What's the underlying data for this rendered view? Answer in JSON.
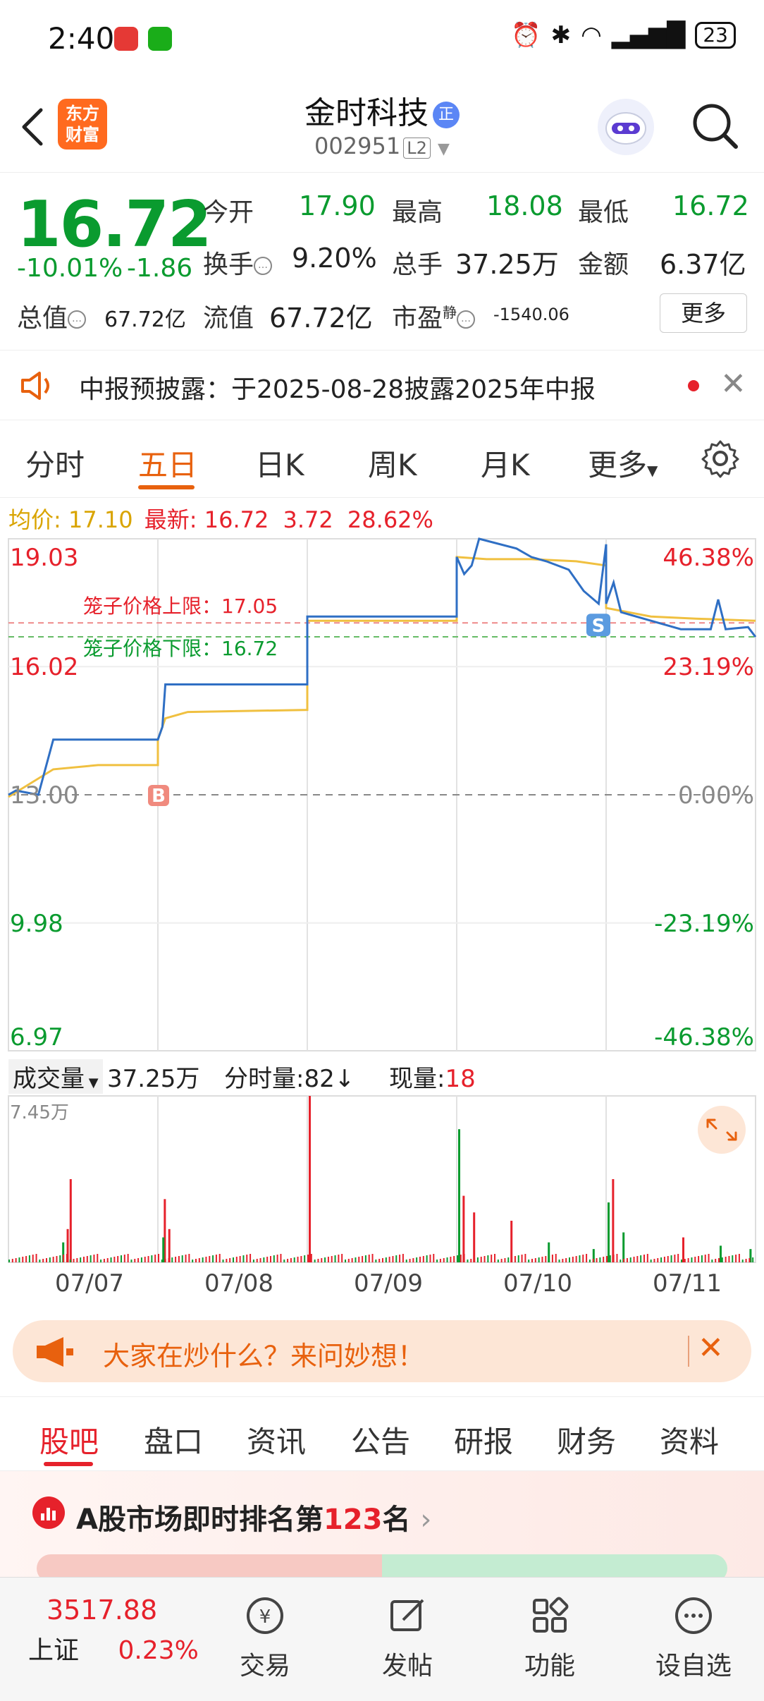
{
  "status_bar": {
    "time": "2:40",
    "battery": "23"
  },
  "header": {
    "logo_text": "东方\n财富",
    "stock_name": "金时科技",
    "official_badge": "正",
    "stock_code": "002951",
    "level_badge": "L2"
  },
  "quote": {
    "price": "16.72",
    "change_pct": "-10.01%",
    "change_amt": "-1.86",
    "fields": {
      "open_label": "今开",
      "open": "17.90",
      "high_label": "最高",
      "high": "18.08",
      "low_label": "最低",
      "low": "16.72",
      "turnover_label": "换手",
      "turnover": "9.20%",
      "volume_label": "总手",
      "volume": "37.25万",
      "amount_label": "金额",
      "amount": "6.37亿",
      "mktcap_label": "总值",
      "mktcap": "67.72亿",
      "float_label": "流值",
      "float": "67.72亿",
      "pe_label": "市盈",
      "pe_sup": "静",
      "pe": "-1540.06"
    },
    "more_button": "更多"
  },
  "notice": {
    "text": "中报预披露：于2025-08-28披露2025年中报"
  },
  "chart_tabs": [
    "分时",
    "五日",
    "日K",
    "周K",
    "月K",
    "更多"
  ],
  "legend": {
    "avg_label": "均价:",
    "avg": "17.10",
    "latest_label": "最新:",
    "latest": "16.72",
    "chg": "3.72",
    "chg_pct": "28.62%"
  },
  "chart_data": {
    "type": "line",
    "title": "",
    "x": [
      "07/07",
      "07/08",
      "07/09",
      "07/10",
      "07/11"
    ],
    "y_left_ticks": [
      "19.03",
      "16.02",
      "13.00",
      "9.98",
      "6.97"
    ],
    "y_right_ticks": [
      "46.38%",
      "23.19%",
      "0.00%",
      "-23.19%",
      "-46.38%"
    ],
    "ylim": [
      6.97,
      19.03
    ],
    "reference_lines": [
      {
        "label": "笼子价格上限：",
        "value": "17.05"
      },
      {
        "label": "笼子价格下限：",
        "value": "16.72"
      }
    ],
    "markers": [
      {
        "label": "B",
        "day": "07/08"
      },
      {
        "label": "S",
        "day": "07/11"
      }
    ],
    "series": [
      {
        "name": "最新",
        "color": "#2f6fc4"
      },
      {
        "name": "均价",
        "color": "#f0c040"
      }
    ],
    "volume": {
      "max_label": "7.45万",
      "label": "成交量",
      "total": "37.25万",
      "minute_label": "分时量:",
      "minute": "82",
      "current_label": "现量:",
      "current": "18"
    }
  },
  "promo": {
    "text": "大家在炒什么？来问妙想！"
  },
  "info_tabs": [
    "股吧",
    "盘口",
    "资讯",
    "公告",
    "研报",
    "财务",
    "资料"
  ],
  "rank": {
    "prefix": "A股市场即时排名第",
    "number": "123",
    "suffix": "名"
  },
  "bottom_bar": {
    "index_value": "3517.88",
    "index_name": "上证",
    "index_pct": "0.23%",
    "nav": [
      {
        "label": "交易",
        "icon": "trade-icon"
      },
      {
        "label": "发帖",
        "icon": "post-icon"
      },
      {
        "label": "功能",
        "icon": "grid-icon"
      },
      {
        "label": "设自选",
        "icon": "more-icon"
      }
    ]
  },
  "colors": {
    "up": "#e6212b",
    "down": "#0a9b2f",
    "accent": "#e8610e",
    "line": "#2f6fc4",
    "avg": "#f0c040"
  }
}
